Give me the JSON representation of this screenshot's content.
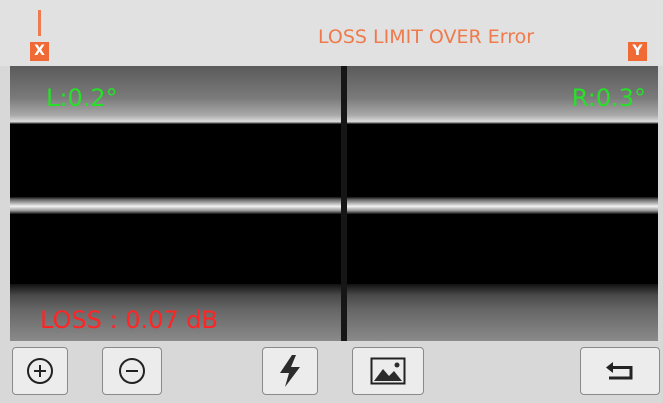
{
  "header": {
    "status_text": "LOSS LIMIT OVER Error",
    "x_axis_tag": "X",
    "y_axis_tag": "Y"
  },
  "left_view": {
    "angle_label": "L:0.2°"
  },
  "right_view": {
    "angle_label": "R:0.3°"
  },
  "loss": {
    "text": "LOSS : 0.07 dB"
  },
  "toolbar": {
    "buttons": [
      {
        "icon": "zoom-in-icon"
      },
      {
        "icon": "zoom-out-icon"
      },
      {
        "icon": "lightning-icon"
      },
      {
        "icon": "image-icon"
      },
      {
        "icon": "return-icon"
      }
    ]
  },
  "colors": {
    "accent_orange": "#ef6a34",
    "angle_green": "#27e028",
    "loss_red": "#ff2525"
  }
}
